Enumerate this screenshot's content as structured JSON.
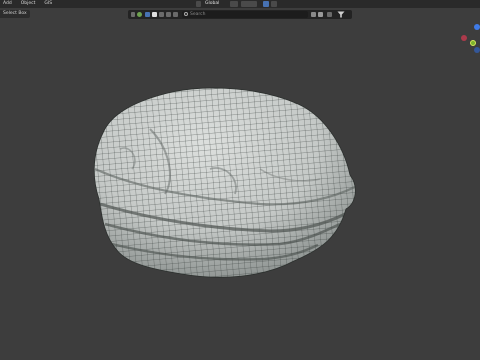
{
  "menu": [
    "Add",
    "Object",
    "GIS"
  ],
  "mode": "Select Box",
  "header": {
    "orientation": "Global"
  },
  "outliner": {
    "search_placeholder": "Search"
  },
  "colors": {
    "viewport_bg": "#3d3d3d",
    "mesh_fill": "#c9ccca",
    "wire": "#2d3230",
    "accent": "#4772b3"
  },
  "icons": [
    "search-icon",
    "filter-icon",
    "gizmo-x-icon",
    "gizmo-y-icon",
    "gizmo-z-icon"
  ]
}
